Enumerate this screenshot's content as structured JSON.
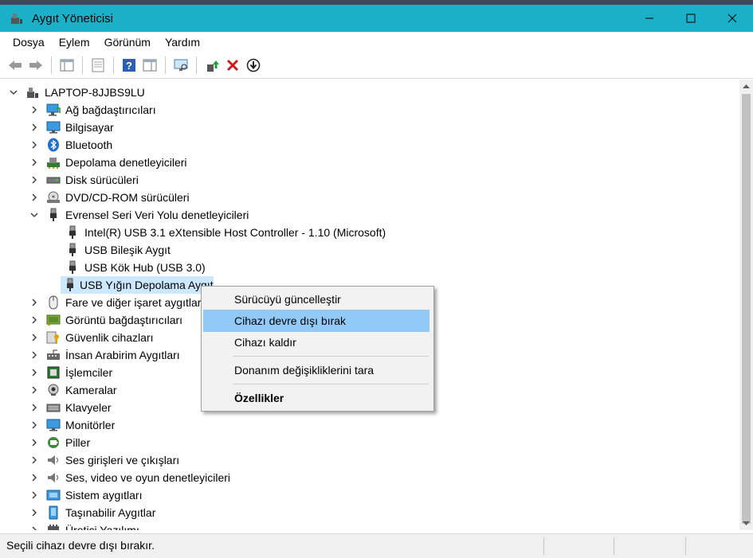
{
  "window": {
    "title": "Aygıt Yöneticisi"
  },
  "menu": [
    "Dosya",
    "Eylem",
    "Görünüm",
    "Yardım"
  ],
  "tree": {
    "root": "LAPTOP-8JJBS9LU",
    "categories": [
      {
        "label": "Ağ bağdaştırıcıları",
        "icon": "network-adapter-icon"
      },
      {
        "label": "Bilgisayar",
        "icon": "computer-icon"
      },
      {
        "label": "Bluetooth",
        "icon": "bluetooth-icon"
      },
      {
        "label": "Depolama denetleyicileri",
        "icon": "storage-controller-icon"
      },
      {
        "label": "Disk sürücüleri",
        "icon": "disk-drive-icon"
      },
      {
        "label": "DVD/CD-ROM sürücüleri",
        "icon": "dvd-drive-icon"
      },
      {
        "label": "Evrensel Seri Veri Yolu denetleyicileri",
        "icon": "usb-icon"
      }
    ],
    "usb_children": [
      "Intel(R) USB 3.1 eXtensible Host Controller - 1.10 (Microsoft)",
      "USB Bileşik Aygıt",
      "USB Kök Hub (USB 3.0)",
      "USB Yığın Depolama Aygıtı"
    ],
    "categories_after": [
      {
        "label": "Fare ve diğer işaret aygıtları",
        "icon": "mouse-icon"
      },
      {
        "label": "Görüntü bağdaştırıcıları",
        "icon": "display-adapter-icon"
      },
      {
        "label": "Güvenlik cihazları",
        "icon": "security-device-icon"
      },
      {
        "label": "İnsan Arabirim Aygıtları",
        "icon": "hid-icon"
      },
      {
        "label": "İşlemciler",
        "icon": "processor-icon"
      },
      {
        "label": "Kameralar",
        "icon": "camera-icon"
      },
      {
        "label": "Klavyeler",
        "icon": "keyboard-icon"
      },
      {
        "label": "Monitörler",
        "icon": "monitor-icon"
      },
      {
        "label": "Piller",
        "icon": "battery-icon"
      },
      {
        "label": "Ses girişleri ve çıkışları",
        "icon": "audio-io-icon"
      },
      {
        "label": "Ses, video ve oyun denetleyicileri",
        "icon": "sound-controller-icon"
      },
      {
        "label": "Sistem aygıtları",
        "icon": "system-device-icon"
      },
      {
        "label": "Taşınabilir Aygıtlar",
        "icon": "portable-device-icon"
      },
      {
        "label": "Üretici Yazılımı",
        "icon": "firmware-icon"
      }
    ]
  },
  "context_menu": {
    "update_driver": "Sürücüyü güncelleştir",
    "disable_device": "Cihazı devre dışı bırak",
    "uninstall_device": "Cihazı kaldır",
    "scan_hardware": "Donanım değişikliklerini tara",
    "properties": "Özellikler"
  },
  "status": {
    "text": "Seçili cihazı devre dışı bırakır."
  },
  "colors": {
    "titlebar": "#19b0c8",
    "selection": "#cce8ff",
    "menu_highlight": "#91c9f7"
  }
}
